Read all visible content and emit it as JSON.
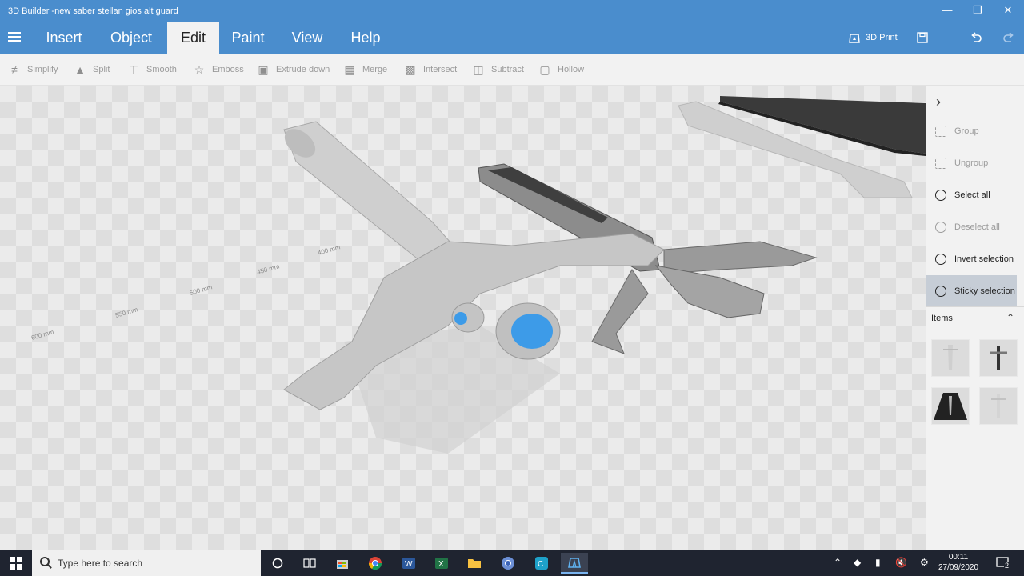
{
  "window": {
    "title": "3D Builder -new saber stellan gios alt guard"
  },
  "tabs": [
    {
      "label": "Insert"
    },
    {
      "label": "Object"
    },
    {
      "label": "Edit",
      "active": true
    },
    {
      "label": "Paint"
    },
    {
      "label": "View"
    },
    {
      "label": "Help"
    }
  ],
  "ribbon_right": {
    "print_label": "3D Print"
  },
  "toolbar": [
    {
      "label": "Simplify",
      "icon": "simplify-icon"
    },
    {
      "label": "Split",
      "icon": "split-icon"
    },
    {
      "label": "Smooth",
      "icon": "smooth-icon"
    },
    {
      "label": "Emboss",
      "icon": "star-icon"
    },
    {
      "label": "Extrude down",
      "icon": "extrude-down-icon"
    },
    {
      "label": "Merge",
      "icon": "merge-icon"
    },
    {
      "label": "Intersect",
      "icon": "intersect-icon"
    },
    {
      "label": "Subtract",
      "icon": "subtract-icon"
    },
    {
      "label": "Hollow",
      "icon": "hollow-icon"
    }
  ],
  "panel": {
    "items": [
      {
        "label": "Group",
        "enabled": false
      },
      {
        "label": "Ungroup",
        "enabled": false
      },
      {
        "label": "Select all",
        "enabled": true
      },
      {
        "label": "Deselect all",
        "enabled": false
      },
      {
        "label": "Invert selection",
        "enabled": true
      },
      {
        "label": "Sticky selection",
        "enabled": true,
        "active": true
      }
    ],
    "items_header": "Items"
  },
  "viewport": {
    "ruler_labels": [
      "600 mm",
      "550 mm",
      "500 mm",
      "450 mm",
      "400 mm"
    ]
  },
  "taskbar": {
    "search_placeholder": "Type here to search",
    "time": "00:11",
    "date": "27/09/2020",
    "notification_count": "2"
  },
  "colors": {
    "accent": "#4a8dcd",
    "taskbar": "#1f2430",
    "model_blue": "#3d9be8"
  }
}
